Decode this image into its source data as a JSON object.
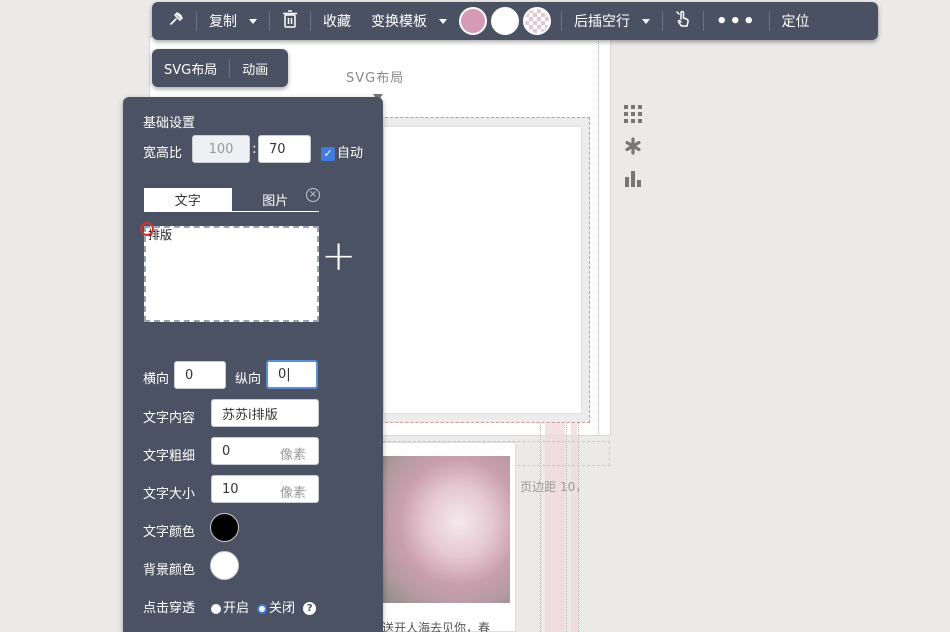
{
  "toolbar": {
    "copy_label": "复制",
    "collect_label": "收藏",
    "template_label": "变换模板",
    "colors": [
      "#d49ab6",
      "#ffffff",
      "checker"
    ],
    "insert_blank_label": "后插空行",
    "locate_label": "定位",
    "more_label": "•••"
  },
  "subbar": {
    "svg_layout_label": "SVG布局",
    "animation_label": "动画"
  },
  "canvas": {
    "svg_title": "SVG布局",
    "caption_line": "3，字间距 2，段落间距 10，页边距 10，",
    "photo_caption": "送开人海去见你，春"
  },
  "panel": {
    "section_title": "基础设置",
    "ratio_label": "宽高比",
    "ratio_width": "100",
    "ratio_separator": ":",
    "ratio_height": "70",
    "auto_label": "自动",
    "auto_checked": true,
    "tabs": [
      {
        "label": "文字",
        "active": true
      },
      {
        "label": "图片",
        "active": false
      }
    ],
    "close_symbol": "×",
    "text_preview": "排版",
    "add_symbol": "+",
    "horizontal_label": "横向",
    "horizontal_value": "0",
    "vertical_label": "纵向",
    "vertical_value": "0|",
    "text_content_label": "文字内容",
    "text_content_value": "苏苏i排版",
    "text_weight_label": "文字粗细",
    "text_weight_value": "0",
    "text_size_label": "文字大小",
    "text_size_value": "10",
    "unit_pixel": "像素",
    "text_color_label": "文字颜色",
    "text_color": "#000000",
    "bg_color_label": "背景颜色",
    "bg_color": "#ffffff",
    "click_through_label": "点击穿透",
    "on_label": "开启",
    "off_label": "关闭",
    "help_symbol": "?"
  }
}
